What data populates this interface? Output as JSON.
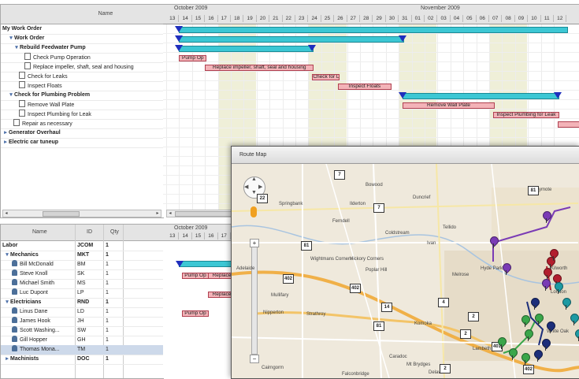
{
  "top_grid": {
    "name_header": "Name",
    "rows": [
      {
        "label": "My Work Order",
        "bold": true,
        "indent": 0,
        "icon": "none"
      },
      {
        "label": "Work Order",
        "bold": true,
        "indent": 1,
        "icon": "expand"
      },
      {
        "label": "Rebuild Feedwater Pump",
        "bold": true,
        "indent": 2,
        "icon": "expand"
      },
      {
        "label": "Check Pump Operation",
        "bold": false,
        "indent": 4,
        "icon": "doc"
      },
      {
        "label": "Replace impeller, shaft, seal and housing",
        "bold": false,
        "indent": 4,
        "icon": "doc"
      },
      {
        "label": "Check for Leaks",
        "bold": false,
        "indent": 3,
        "icon": "doc"
      },
      {
        "label": "Inspect Floats",
        "bold": false,
        "indent": 3,
        "icon": "doc"
      },
      {
        "label": "Check for Plumbing Problem",
        "bold": true,
        "indent": 1,
        "icon": "expand"
      },
      {
        "label": "Remove Wall Plate",
        "bold": false,
        "indent": 3,
        "icon": "doc"
      },
      {
        "label": "Inspect Plumbing for Leak",
        "bold": false,
        "indent": 3,
        "icon": "doc"
      },
      {
        "label": "Repair as necessary",
        "bold": false,
        "indent": 2,
        "icon": "doc"
      },
      {
        "label": "Generator Overhaul",
        "bold": true,
        "indent": 0,
        "icon": "collapsed"
      },
      {
        "label": "Electric car tuneup",
        "bold": true,
        "indent": 0,
        "icon": "collapsed"
      }
    ]
  },
  "timeline": {
    "month1": "October 2009",
    "month2": "November 2009",
    "days": [
      "13",
      "14",
      "15",
      "16",
      "17",
      "18",
      "19",
      "20",
      "21",
      "22",
      "23",
      "24",
      "25",
      "26",
      "27",
      "28",
      "29",
      "30",
      "31",
      "01",
      "02",
      "03",
      "04",
      "05",
      "06",
      "07",
      "08",
      "09",
      "10",
      "11",
      "12"
    ],
    "task_labels": {
      "check_pump": "Pump Op",
      "replace": "Replace impeller, shaft, seal and housing",
      "check_leaks": "Check for Leaks",
      "inspect_floats": "Inspect Floats",
      "remove_plate": "Remove Wall Plate",
      "inspect_plumbing": "Inspect Plumbing for Leak"
    }
  },
  "resource_grid": {
    "headers": {
      "name": "Name",
      "id": "ID",
      "qty": "Qty"
    },
    "rows": [
      {
        "name": "Labor",
        "id": "JCOM",
        "qty": "1",
        "type": "group0"
      },
      {
        "name": "Mechanics",
        "id": "MKT",
        "qty": "1",
        "type": "group"
      },
      {
        "name": "Bill McDonald",
        "id": "BM",
        "qty": "1",
        "type": "person"
      },
      {
        "name": "Steve Knoll",
        "id": "SK",
        "qty": "1",
        "type": "person"
      },
      {
        "name": "Michael Smith",
        "id": "MS",
        "qty": "1",
        "type": "person"
      },
      {
        "name": "Luc Dupont",
        "id": "LP",
        "qty": "1",
        "type": "person"
      },
      {
        "name": "Electricians",
        "id": "RND",
        "qty": "1",
        "type": "group"
      },
      {
        "name": "Linus Dane",
        "id": "LD",
        "qty": "1",
        "type": "person"
      },
      {
        "name": "James Hook",
        "id": "JH",
        "qty": "1",
        "type": "person"
      },
      {
        "name": "Scott Washing...",
        "id": "SW",
        "qty": "1",
        "type": "person"
      },
      {
        "name": "Gill Hopper",
        "id": "GH",
        "qty": "1",
        "type": "person"
      },
      {
        "name": "Thomas Mona...",
        "id": "TM",
        "qty": "1",
        "type": "person",
        "selected": true
      },
      {
        "name": "Machinists",
        "id": "DOC",
        "qty": "1",
        "type": "group"
      }
    ]
  },
  "resource_timeline": {
    "month1": "October 2009",
    "days": [
      "13",
      "14",
      "15",
      "16",
      "17",
      "18",
      "19"
    ],
    "labels": {
      "pump": "Pump Op",
      "replace": "Replace",
      "pump2": "Pump Op"
    }
  },
  "map": {
    "title": "Route Map",
    "cities": [
      "Bowood",
      "Duncrief",
      "Ballymote",
      "Springbank",
      "Ferndell",
      "Ilderton",
      "Coldstream",
      "Hickory Corners",
      "Poplar Hill",
      "Melrose",
      "Tellido",
      "Ivan",
      "Hyde Park",
      "London",
      "Adelaide",
      "Wightmans Corners",
      "Kilworth",
      "Mullifary",
      "Nipperton",
      "Strathroy",
      "Komoka",
      "Lambeth",
      "Caradoc",
      "Mt Brydges",
      "Cairngorm",
      "Falconbridge",
      "Delaware",
      "White Oak"
    ],
    "highways": [
      "7",
      "22",
      "7",
      "81",
      "81",
      "402",
      "402",
      "4",
      "2",
      "2",
      "401",
      "81",
      "2",
      "14",
      "402"
    ],
    "colors": {
      "route_purple": "#7a3bb5",
      "route_green": "#3aa64a",
      "route_navy": "#1c2e7a",
      "route_red": "#b21e2e",
      "route_teal": "#1d9aa3",
      "road_orange": "#f0b048"
    }
  }
}
